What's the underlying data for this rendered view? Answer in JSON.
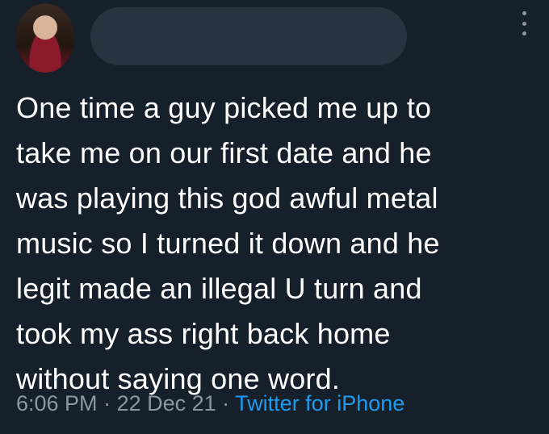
{
  "tweet": {
    "lines": [
      "One time a guy picked me up to",
      "take me on our first date and he",
      "was playing this god awful metal",
      "music so I turned it down and he",
      "legit made an illegal U turn and",
      "took my ass right back home",
      "without saying one word."
    ],
    "time": "6:06 PM",
    "separator": " · ",
    "date": "22 Dec 21",
    "source": "Twitter for iPhone"
  },
  "icons": {
    "more": "more-vertical-icon"
  },
  "colors": {
    "background": "#15202b",
    "text": "#ffffff",
    "muted": "#8899a6",
    "link": "#1d9bf0",
    "redaction": "#273340"
  }
}
